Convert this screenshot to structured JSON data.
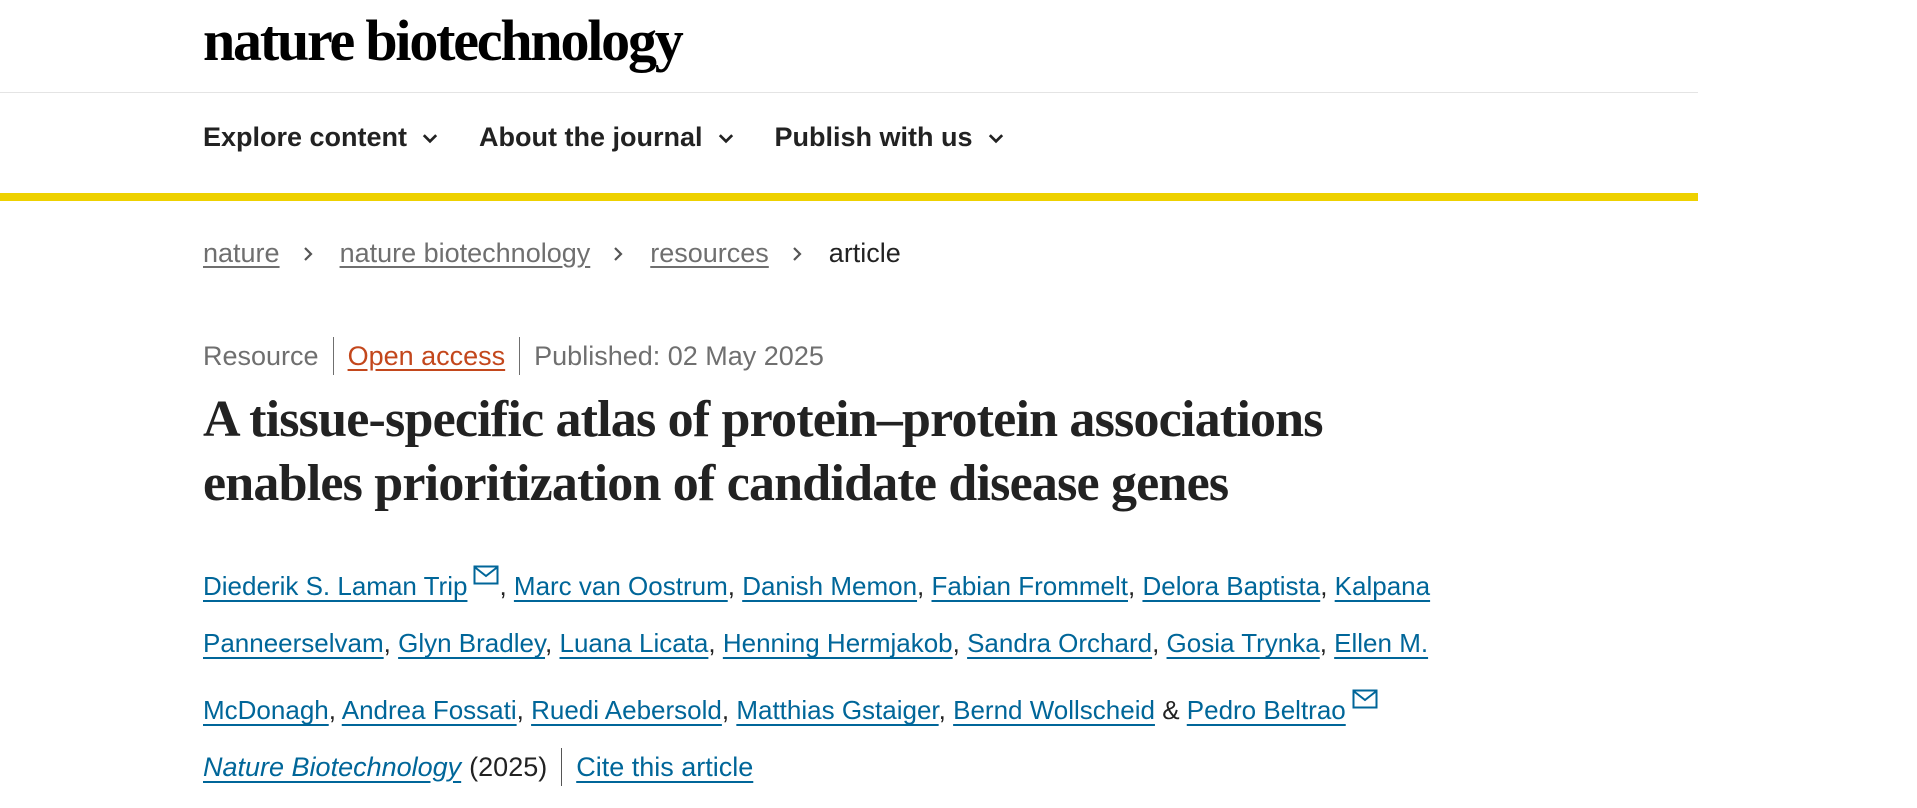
{
  "header": {
    "logo": "nature biotechnology"
  },
  "nav": {
    "items": [
      {
        "label": "Explore content"
      },
      {
        "label": "About the journal"
      },
      {
        "label": "Publish with us"
      }
    ]
  },
  "breadcrumb": {
    "items": [
      "nature",
      "nature biotechnology",
      "resources"
    ],
    "current": "article"
  },
  "meta": {
    "type": "Resource",
    "access": "Open access",
    "published": "Published: 02 May 2025"
  },
  "title": {
    "line1": "A tissue-specific atlas of protein–protein associations",
    "line2": "enables prioritization of candidate disease genes"
  },
  "authors": [
    "Diederik S. Laman Trip",
    "Marc van Oostrum",
    "Danish Memon",
    "Fabian Frommelt",
    "Delora Baptista",
    "Kalpana Panneerselvam",
    "Glyn Bradley",
    "Luana Licata",
    "Henning Hermjakob",
    "Sandra Orchard",
    "Gosia Trynka",
    "Ellen M. McDonagh",
    "Andrea Fossati",
    "Ruedi Aebersold",
    "Matthias Gstaiger",
    "Bernd Wollscheid",
    "Pedro Beltrao"
  ],
  "authors_connector": "&",
  "citation": {
    "journal": "Nature Biotechnology",
    "year": "(2025)",
    "cite_label": "Cite this article"
  },
  "colors": {
    "accent_bar": "#eed100",
    "link": "#006699",
    "open_access": "#c3471c"
  },
  "icons": [
    "chevron-down-icon",
    "chevron-right-icon",
    "mail-icon"
  ]
}
